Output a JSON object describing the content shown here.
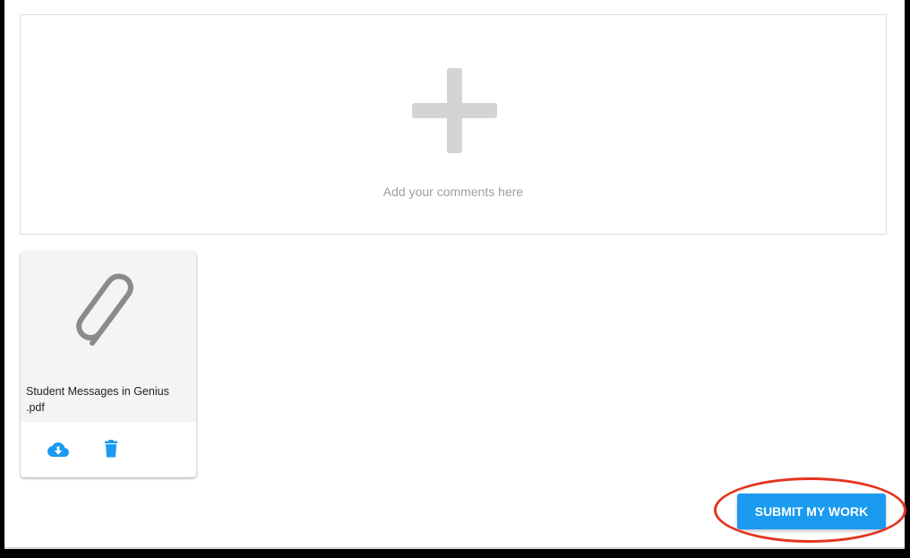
{
  "comments": {
    "placeholder": "Add your comments here",
    "add_icon": "plus-icon"
  },
  "attachment": {
    "file_name": "Student Messages in Genius\n.pdf",
    "icon": "paperclip-icon",
    "actions": [
      "download-icon",
      "delete-icon"
    ],
    "accent_color": "#1a9bf0"
  },
  "actions": {
    "submit_label": "SUBMIT MY WORK"
  },
  "annotation": {
    "highlight_color": "#e5341e"
  }
}
